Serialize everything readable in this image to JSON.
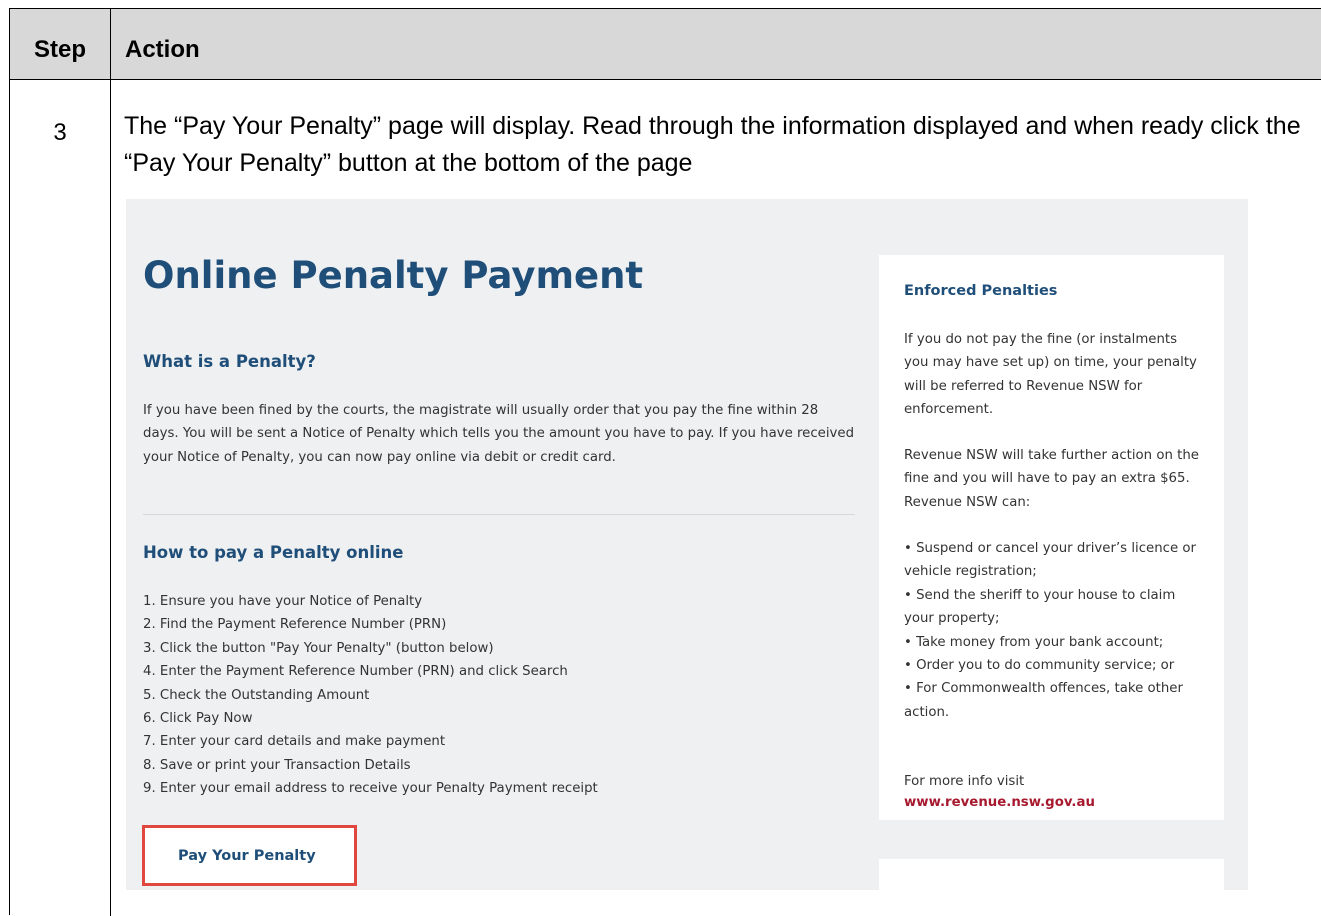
{
  "table": {
    "header_step": "Step",
    "header_action": "Action",
    "step_number": "3",
    "instruction": "The “Pay Your Penalty” page will display. Read through the information displayed and when ready click the “Pay Your Penalty” button at the bottom of the page"
  },
  "page": {
    "title": "Online Penalty Payment",
    "what_heading": "What is a Penalty?",
    "what_text": "If you have been fined by the courts, the magistrate will usually order that you pay the fine within 28 days. You will be sent a Notice of Penalty which tells you the amount you have to pay. If you have received your Notice of Penalty, you can now pay online via debit or credit card.",
    "how_heading": "How to pay a Penalty online",
    "steps": [
      "1. Ensure you have your Notice of Penalty",
      "2. Find the Payment Reference Number (PRN)",
      "3. Click the button \"Pay Your Penalty\" (button below)",
      "4. Enter the Payment Reference Number (PRN) and click Search",
      "5. Check the Outstanding Amount",
      "6. Click Pay Now",
      "7. Enter your card details and make payment",
      "8. Save or print your Transaction Details",
      "9. Enter your email address to receive your Penalty Payment receipt"
    ],
    "pay_button": "Pay Your Penalty"
  },
  "sidebar": {
    "heading": "Enforced Penalties",
    "para1": "If you do not pay the fine (or instalments you may have set up) on time, your penalty will be referred to Revenue NSW for enforcement.",
    "para2": "Revenue NSW will take further action on the fine and you will have to pay an extra $65. Revenue NSW can:",
    "bullets": [
      "• Suspend or cancel your driver’s licence or vehicle registration;",
      "• Send the sheriff to your house to claim your property;",
      "• Take money from your bank account;",
      "• Order you to do community service; or",
      "• For Commonwealth offences, take other action."
    ],
    "more_info": "For more info visit",
    "link": "www.revenue.nsw.gov.au"
  },
  "colors": {
    "heading_blue": "#1f4e79",
    "link_red": "#a6192e",
    "highlight_red": "#e0483f",
    "header_gray": "#d8d8d8"
  }
}
